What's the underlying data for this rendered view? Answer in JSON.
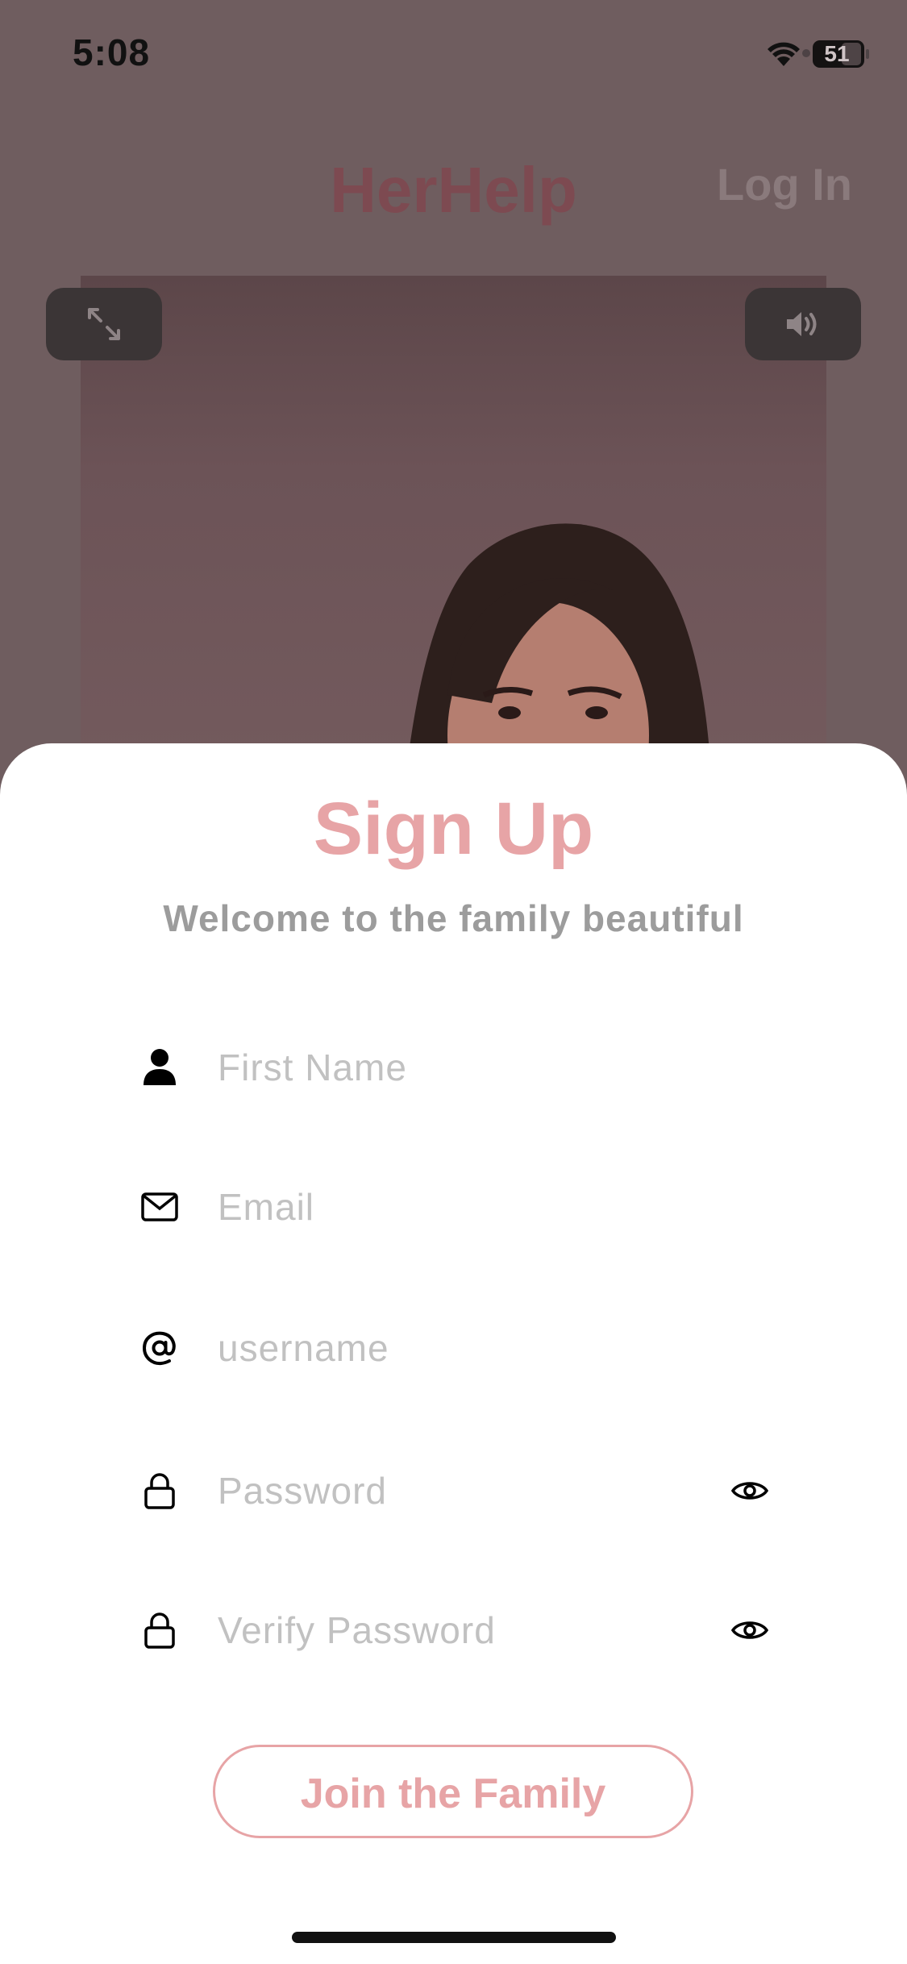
{
  "status_bar": {
    "time": "5:08",
    "battery": "51"
  },
  "header": {
    "app_title": "HerHelp",
    "login_label": "Log In"
  },
  "video": {
    "expand_icon": "expand-arrows-icon",
    "volume_icon": "speaker-icon"
  },
  "sheet": {
    "title": "Sign Up",
    "subtitle": "Welcome to the family beautiful",
    "fields": [
      {
        "placeholder": "First Name",
        "icon": "person-icon"
      },
      {
        "placeholder": "Email",
        "icon": "envelope-icon"
      },
      {
        "placeholder": "username",
        "icon": "at-sign-icon"
      },
      {
        "placeholder": "Password",
        "icon": "lock-icon"
      },
      {
        "placeholder": "Verify Password",
        "icon": "lock-icon"
      }
    ],
    "submit_label": "Join the Family"
  },
  "colors": {
    "accent": "#e7a4a6",
    "subtitle": "#9c9c9c",
    "overlay": "#6f5d5f"
  }
}
